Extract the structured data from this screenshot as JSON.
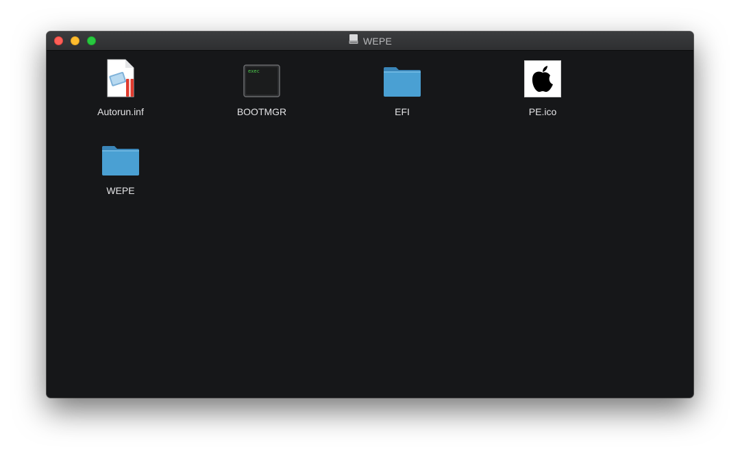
{
  "window": {
    "title": "WEPE",
    "title_icon": "drive-icon"
  },
  "items": [
    {
      "name": "Autorun.inf",
      "icon": "inf-file-icon"
    },
    {
      "name": "BOOTMGR",
      "icon": "exec-file-icon",
      "icon_text": "exec"
    },
    {
      "name": "EFI",
      "icon": "folder-icon"
    },
    {
      "name": "PE.ico",
      "icon": "apple-logo-icon"
    },
    {
      "name": "WEPE",
      "icon": "folder-icon"
    }
  ],
  "colors": {
    "window_bg": "#161719",
    "folder_blue": "#4aa0d3",
    "close": "#fe5f57",
    "minimize": "#febc2e",
    "maximize": "#28c840"
  }
}
